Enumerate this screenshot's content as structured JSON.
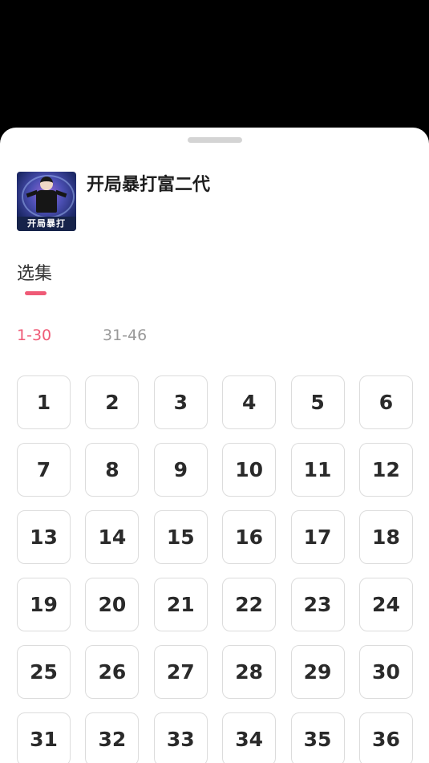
{
  "drama": {
    "title": "开局暴打富二代",
    "cover_text": "开局暴打"
  },
  "section": {
    "title": "选集"
  },
  "ranges": [
    {
      "label": "1-30",
      "active": true
    },
    {
      "label": "31-46",
      "active": false
    }
  ],
  "episodes": [
    "1",
    "2",
    "3",
    "4",
    "5",
    "6",
    "7",
    "8",
    "9",
    "10",
    "11",
    "12",
    "13",
    "14",
    "15",
    "16",
    "17",
    "18",
    "19",
    "20",
    "21",
    "22",
    "23",
    "24",
    "25",
    "26",
    "27",
    "28",
    "29",
    "30",
    "31",
    "32",
    "33",
    "34",
    "35",
    "36"
  ],
  "colors": {
    "accent": "#ef5a76",
    "inactive": "#999999",
    "border": "#dcdcdc",
    "backdrop": "#000000"
  }
}
